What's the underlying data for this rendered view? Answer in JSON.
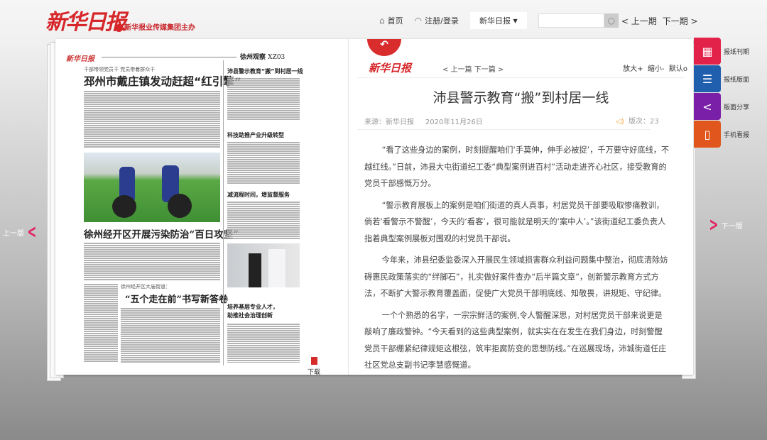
{
  "header": {
    "logo": "新华日报",
    "sublogo": "新华报业传媒集团主办",
    "nav": {
      "home": "首页",
      "login": "注册/登录",
      "paper_select": "新华日报",
      "search_placeholder": "",
      "prev_issue": "< 上一期",
      "next_issue": "下一期 >"
    }
  },
  "pager": {
    "prev_page": "上一版",
    "next_page": "下一版"
  },
  "newspaper": {
    "masthead": "新华日报",
    "section": "徐州观察",
    "page_no": "XZ03",
    "kicker1": "干部带领党员干 党员带着群众干",
    "headline1": "邳州市戴庄镇发动赶超“红引擎”",
    "right_h1": "沛县警示教育“搬”到村居一线",
    "right_h2": "科技助推产业升级转型",
    "right_h3": "减流程时间，增监督服务",
    "headline2": "徐州经开区开展污染防治“百日攻坚”",
    "kicker3": "徐州经开区大庙街道：",
    "headline3": "“五个走在前”书写新答卷",
    "right_h4": "培养基层专业人才，",
    "right_h4b": "助推社会治理创新",
    "download": "下载"
  },
  "article": {
    "prev": "< 上一篇",
    "next": "下一篇 >",
    "zoom_in": "放大+",
    "zoom_out": "缩小-",
    "default": "默认o",
    "title": "沛县警示教育“搬”到村居一线",
    "source": "来源：新华日报",
    "date": "2020年11月26日",
    "edition": "版次：23",
    "paragraphs": [
      "“看了这些身边的案例，时刻提醒咱们‘手莫伸，伸手必被捉’，千万要守好底线，不越红线。”日前，沛县大屯街道纪工委“典型案例进百村”活动走进齐心社区，接受教育的党员干部感慨万分。",
      "“警示教育展板上的案例是咱们街道的真人真事，村居党员干部要吸取惨痛教训，倘若‘看警示不警醒’，今天的‘看客’，很可能就是明天的‘案中人’。”该街道纪工委负责人指着典型案例展板对围观的村党员干部说。",
      "今年来，沛县纪委监委深入开展民生领域损害群众利益问题集中整治，彻底清除妨碍惠民政策落实的“绊脚石”，扎实做好案件查办“后半篇文章”，创新警示教育方式方法，不断扩大警示教育覆盖面，促使广大党员干部明底线、知敬畏，讲规矩、守纪律。",
      "一个个熟悉的名字，一宗宗鲜活的案例,令人警醒深思，对村居党员干部来说更是敲响了廉政警钟。“今天看到的这些典型案例，就实实在在发生在我们身边，时刻警醒党员干部绷紧纪律规矩这根弦，筑牢拒腐防变的思想防线。”在巡展现场，沛城街道任庄社区党总支副书记李慧感慨道。"
    ]
  },
  "sidebar": [
    {
      "label": "报纸刊期",
      "icon": "calendar-icon",
      "color": "#e3224a"
    },
    {
      "label": "报纸版面",
      "icon": "list-icon",
      "color": "#1f5fae"
    },
    {
      "label": "版面分享",
      "icon": "share-icon",
      "color": "#7a1fa8"
    },
    {
      "label": "手机看报",
      "icon": "mobile-icon",
      "color": "#e0561c"
    }
  ]
}
